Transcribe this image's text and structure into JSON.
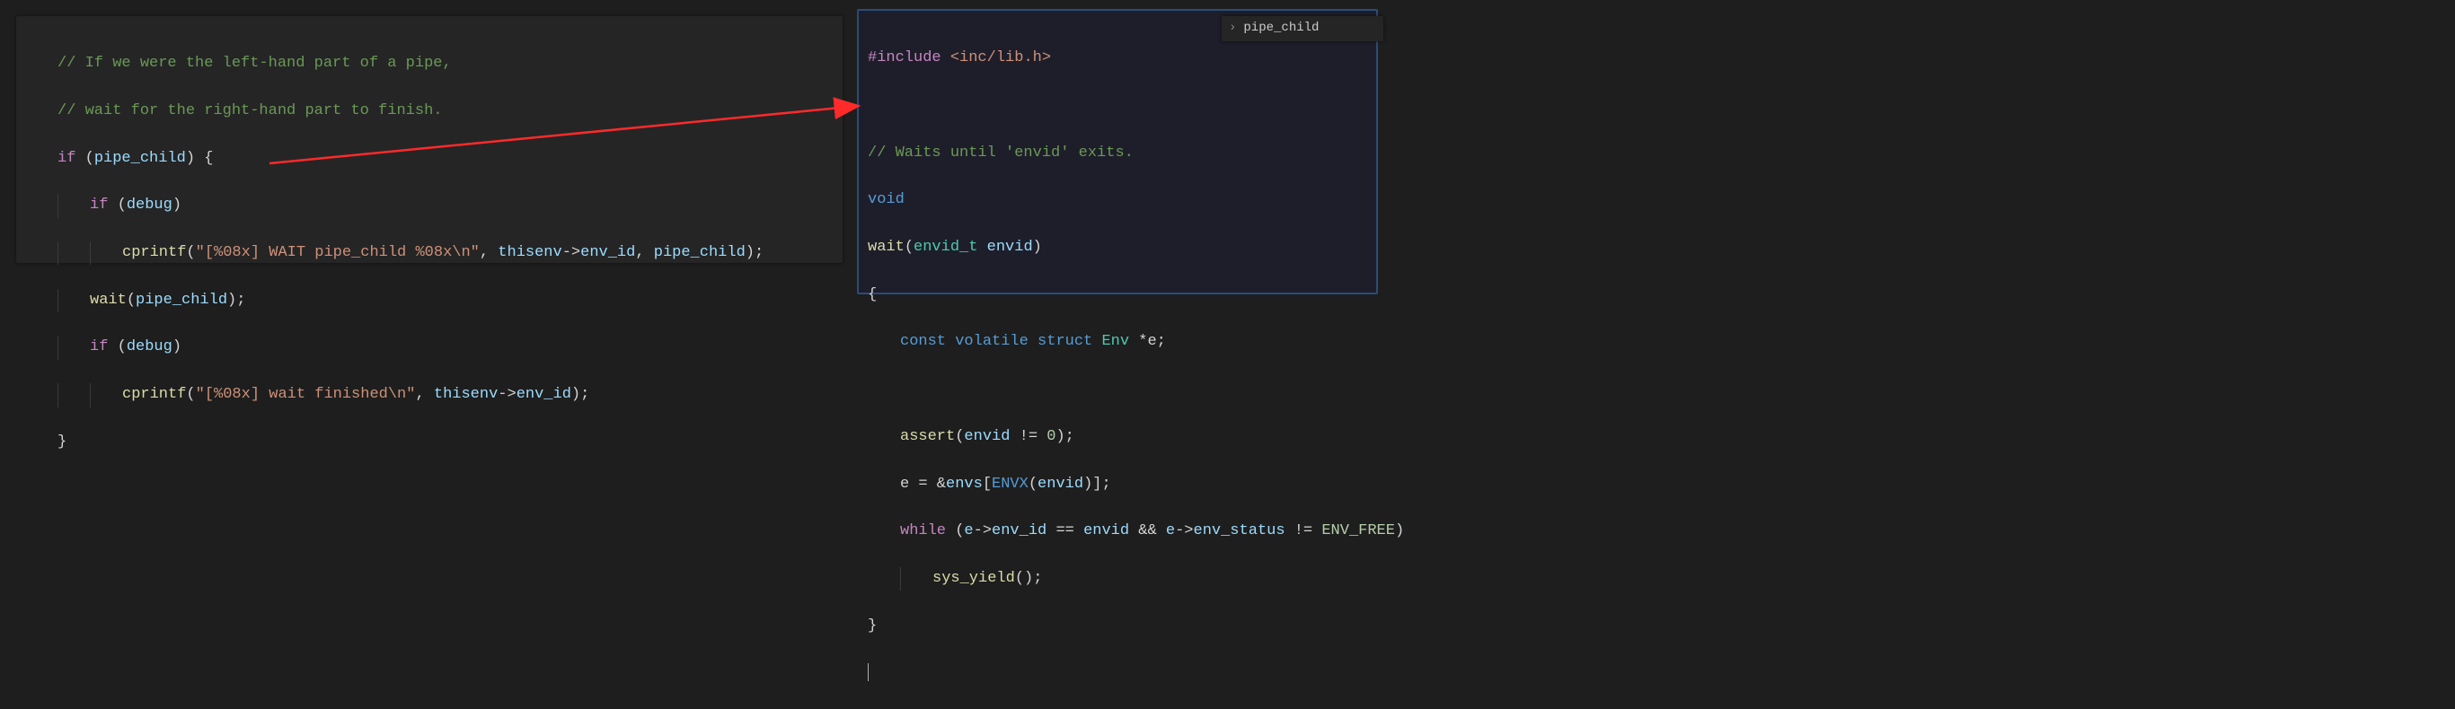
{
  "breadcrumb": {
    "chevron": "›",
    "label": "pipe_child"
  },
  "left": {
    "l1_a": "// If we were the left-hand part of a pipe,",
    "l2_a": "// wait for the right-hand part to finish.",
    "l3_kw": "if",
    "l3_op1": " (",
    "l3_id": "pipe_child",
    "l3_op2": ") {",
    "l4_kw": "if",
    "l4_op1": " (",
    "l4_id": "debug",
    "l4_op2": ")",
    "l5_fn": "cprintf",
    "l5_op1": "(",
    "l5_str": "\"[%08x] WAIT pipe_child %08x\\n\"",
    "l5_c1": ", ",
    "l5_id1": "thisenv",
    "l5_arrow": "->",
    "l5_id2": "env_id",
    "l5_c2": ", ",
    "l5_id3": "pipe_child",
    "l5_op2": ");",
    "l6_fn": "wait",
    "l6_op1": "(",
    "l6_id": "pipe_child",
    "l6_op2": ");",
    "l7_kw": "if",
    "l7_op1": " (",
    "l7_id": "debug",
    "l7_op2": ")",
    "l8_fn": "cprintf",
    "l8_op1": "(",
    "l8_str": "\"[%08x] wait finished\\n\"",
    "l8_c1": ", ",
    "l8_id1": "thisenv",
    "l8_arrow": "->",
    "l8_id2": "env_id",
    "l8_op2": ");",
    "l9": "}"
  },
  "right": {
    "l1_pp": "#include",
    "l1_sp": " ",
    "l1_path": "<inc/lib.h>",
    "l3": "// Waits until 'envid' exits.",
    "l4": "void",
    "l5_fn": "wait",
    "l5_o1": "(",
    "l5_typ": "envid_t",
    "l5_sp": " ",
    "l5_id": "envid",
    "l5_o2": ")",
    "l6": "{",
    "l7_kw1": "const",
    "l7_kw2": " volatile",
    "l7_kw3": " struct",
    "l7_typ": " Env",
    "l7_rest": " *e;",
    "l9_fn": "assert",
    "l9_o1": "(",
    "l9_id": "envid",
    "l9_op": " != ",
    "l9_num": "0",
    "l9_o2": ");",
    "l10_a": "e = &",
    "l10_id1": "envs",
    "l10_o1": "[",
    "l10_fn": "ENVX",
    "l10_o2": "(",
    "l10_id2": "envid",
    "l10_o3": ")];",
    "l11_kw": "while",
    "l11_o1": " (",
    "l11_id1": "e",
    "l11_arr1": "->",
    "l11_id2": "env_id",
    "l11_op1": " == ",
    "l11_id3": "envid",
    "l11_op2": " && ",
    "l11_id4": "e",
    "l11_arr2": "->",
    "l11_id5": "env_status",
    "l11_op3": " != ",
    "l11_enum": "ENV_FREE",
    "l11_o2": ")",
    "l12_fn": "sys_yield",
    "l12_o": "();",
    "l13": "}"
  }
}
